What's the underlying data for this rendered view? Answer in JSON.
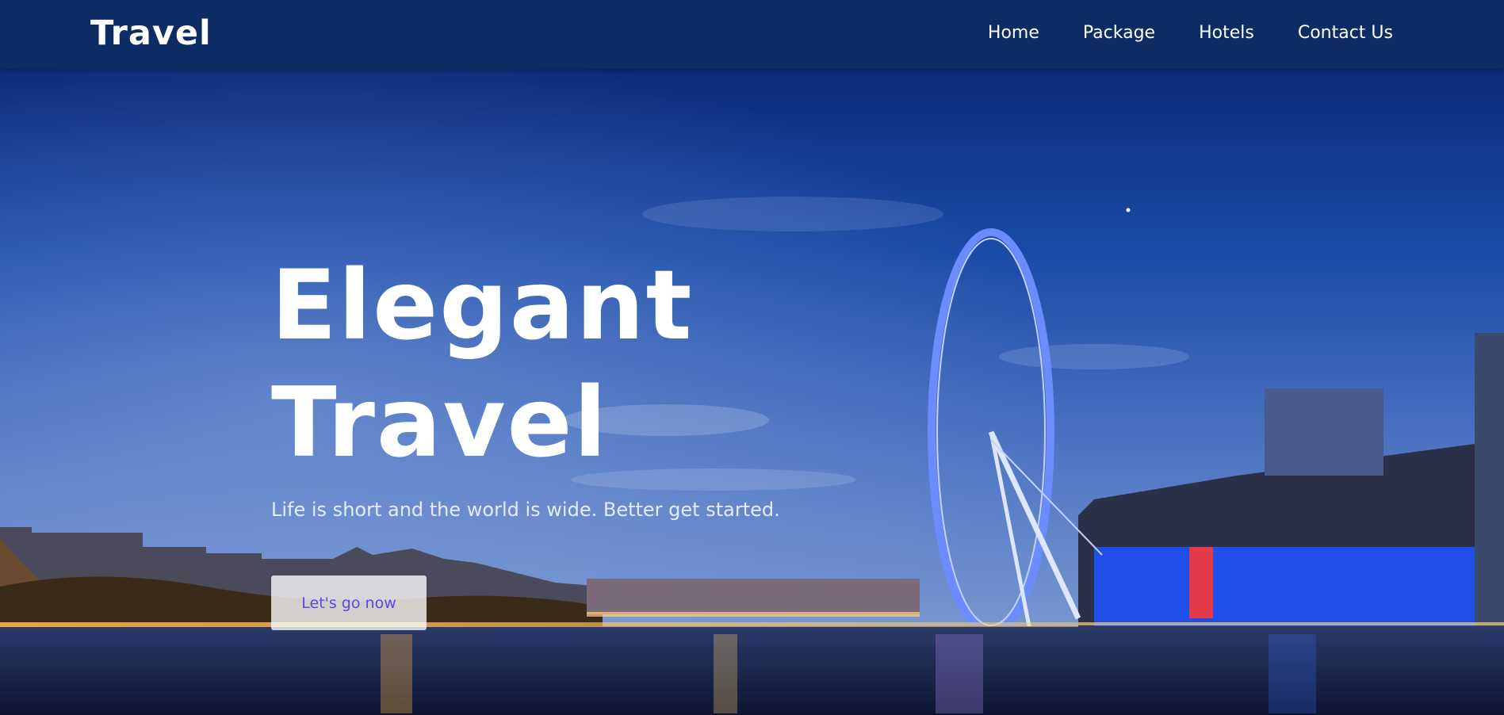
{
  "header": {
    "brand": "Travel",
    "nav": [
      {
        "label": "Home"
      },
      {
        "label": "Package"
      },
      {
        "label": "Hotels"
      },
      {
        "label": "Contact Us"
      }
    ]
  },
  "hero": {
    "title_line1": "Elegant",
    "title_line2": "Travel",
    "subtitle": "Life is short and the world is wide. Better get started.",
    "cta_label": "Let's go now"
  },
  "colors": {
    "navbar": "#0c2c63",
    "sky_top": "#0a2a78",
    "sky_bottom": "#6f8fcf",
    "cta_text": "#5a48e6",
    "wheel": "#6b8cff"
  }
}
